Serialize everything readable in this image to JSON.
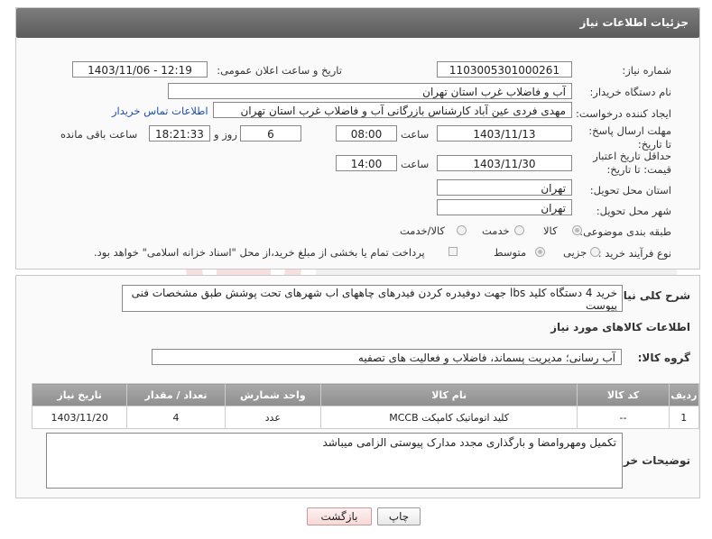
{
  "header": {
    "title": "جزئیات اطلاعات نیاز"
  },
  "fields": {
    "need_number_label": "شماره نیاز:",
    "need_number": "1103005301000261",
    "announce_label": "تاریخ و ساعت اعلان عمومی:",
    "announce_value": "1403/11/06 - 12:19",
    "buyer_org_label": "نام دستگاه خریدار:",
    "buyer_org": "آب و فاضلاب غرب استان تهران",
    "requester_label": "ایجاد کننده درخواست:",
    "requester": "مهدی فردی عین آباد کارشناس بازرگانی آب و فاضلاب غرب استان تهران",
    "contact_link": "اطلاعات تماس خریدار",
    "deadline_label": "مهلت ارسال پاسخ: تا تاریخ:",
    "deadline_date": "1403/11/13",
    "time_label": "ساعت",
    "deadline_time": "08:00",
    "days": "6",
    "days_label": "روز و",
    "remaining": "18:21:33",
    "remaining_label": "ساعت باقی مانده",
    "validity_label": "حداقل تاریخ اعتبار قیمت: تا تاریخ:",
    "validity_date": "1403/11/30",
    "validity_time_label": "ساعت",
    "validity_time": "14:00",
    "province_label": "استان محل تحویل:",
    "province": "تهران",
    "city_label": "شهر محل تحویل:",
    "city": "تهران",
    "category_label": "طبقه بندی موضوعی:",
    "cat_goods": "کالا",
    "cat_service": "خدمت",
    "cat_goods_service": "کالا/خدمت",
    "process_label": "نوع فرآیند خرید :",
    "proc_partial": "جزیی",
    "proc_medium": "متوسط",
    "payment_note": "پرداخت تمام یا بخشی از مبلغ خرید،از محل \"اسناد خزانه اسلامی\" خواهد بود."
  },
  "description": {
    "label": "شرح کلی نیاز:",
    "text": "خرید 4 دستگاه کلید lbs جهت دوفیدره کردن فیدرهای چاههای اب شهرهای تحت پوشش طبق مشخصات فنی پیوست"
  },
  "goods_section": {
    "title": "اطلاعات کالاهای مورد نیاز",
    "group_label": "گروه کالا:",
    "group_value": "آب رسانی؛ مدیریت پسماند، فاضلاب و فعالیت های تصفیه"
  },
  "table": {
    "headers": [
      "ردیف",
      "کد کالا",
      "نام کالا",
      "واحد شمارش",
      "تعداد / مقدار",
      "تاریخ نیاز"
    ],
    "rows": [
      [
        "1",
        "--",
        "کلید اتوماتیک کامپکت MCCB",
        "عدد",
        "4",
        "1403/11/20"
      ]
    ]
  },
  "buyer_notes": {
    "label": "توضیحات خریدار:",
    "text": "تکمیل ومهروامضا و بارگذاری مجدد مدارک پیوستی الزامی میباشد"
  },
  "buttons": {
    "print": "چاپ",
    "back": "بازگشت"
  }
}
